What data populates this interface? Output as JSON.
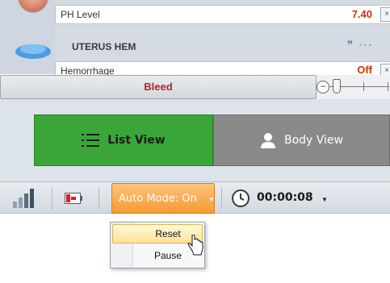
{
  "vitals": {
    "ph_label": "PH Level",
    "ph_value": "7.40",
    "close_glyph": "×"
  },
  "uterus_hem": {
    "title": "UTERUS HEM",
    "more_glyph": "···",
    "hem_label": "Hemorrhage",
    "hem_value": "Off"
  },
  "bleed": {
    "label": "Bleed"
  },
  "view_toggle": {
    "list_label": "List View",
    "body_label": "Body View",
    "active": "List View"
  },
  "toolbar": {
    "auto_mode_label": "Auto Mode: On",
    "timer": "00:00:08"
  },
  "auto_menu": {
    "items": [
      "Reset",
      "Pause"
    ],
    "highlighted": "Reset"
  },
  "colors": {
    "accent_orange": "#f59a33",
    "list_active_green": "#3aa63a",
    "body_inactive_gray": "#8a8a8a",
    "value_red": "#cc3300"
  }
}
